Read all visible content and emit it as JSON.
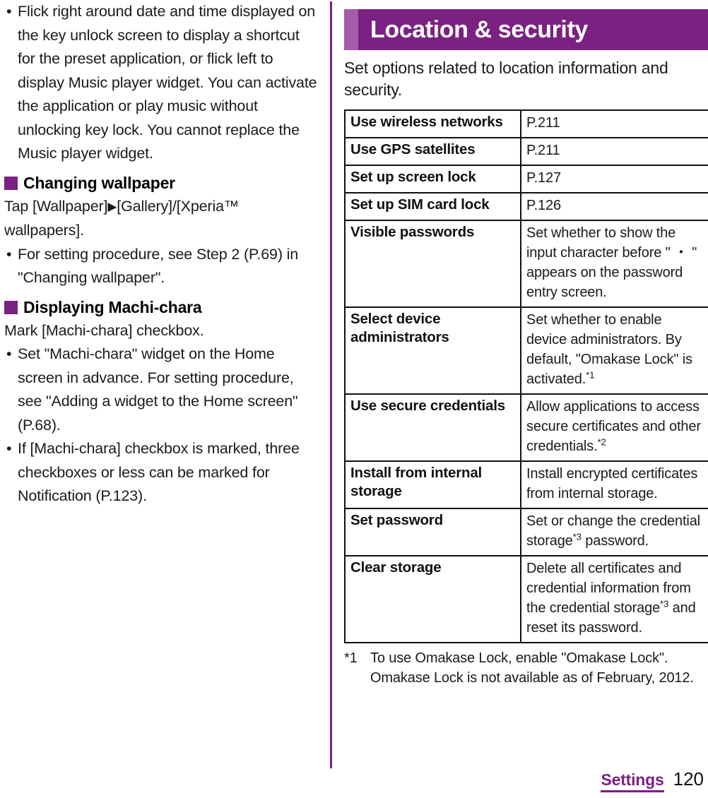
{
  "left_column": {
    "lead_bullet": {
      "marker": "•",
      "text": "Flick right around date and time displayed on the key unlock screen to display a shortcut for the preset application, or flick left to display Music player widget. You can activate the application or play music without unlocking key lock. You cannot replace the Music player widget."
    },
    "sections": [
      {
        "heading": "Changing wallpaper",
        "body_line": "Tap [Wallpaper]",
        "body_line_arrow": "▶",
        "body_line_rest": "[Gallery]/[Xperia™ wallpapers].",
        "bullets": [
          {
            "marker": "•",
            "text": "For setting procedure, see Step 2 (P.69) in \"Changing wallpaper\"."
          }
        ]
      },
      {
        "heading": "Displaying Machi-chara",
        "body_line": "Mark [Machi-chara] checkbox.",
        "bullets": [
          {
            "marker": "•",
            "text": "Set \"Machi-chara\" widget on the Home screen in advance. For setting procedure, see \"Adding a widget to the Home screen\" (P.68)."
          },
          {
            "marker": "•",
            "text": "If [Machi-chara] checkbox is marked, three checkboxes or less can be marked for Notification (P.123)."
          }
        ]
      }
    ]
  },
  "right_column": {
    "title": "Location & security",
    "intro": "Set options related to location information and security.",
    "table": {
      "rows": [
        {
          "name": "Use wireless networks",
          "desc": "P.211",
          "desc_sup": ""
        },
        {
          "name": "Use GPS satellites",
          "desc": "P.211",
          "desc_sup": ""
        },
        {
          "name": "Set up screen lock",
          "desc": "P.127",
          "desc_sup": ""
        },
        {
          "name": "Set up SIM card lock",
          "desc": "P.126",
          "desc_sup": ""
        },
        {
          "name": "Visible passwords",
          "desc": "Set whether to show the input character before \" ・ \" appears on the password entry screen.",
          "desc_sup": ""
        },
        {
          "name": "Select device administrators",
          "desc": "Set whether to enable device administrators. By default, \"Omakase Lock\" is activated.",
          "desc_sup": "*1"
        },
        {
          "name": "Use secure credentials",
          "desc": "Allow applications to access secure certificates and other credentials.",
          "desc_sup": "*2"
        },
        {
          "name": "Install from internal storage",
          "desc": "Install encrypted certificates from internal storage.",
          "desc_sup": ""
        },
        {
          "name": "Set password",
          "desc_pre": "Set or change the credential storage",
          "desc_sup": "*3",
          "desc_post": " password.",
          "desc": ""
        },
        {
          "name": "Clear storage",
          "desc_pre": "Delete all certificates and credential information from the credential storage",
          "desc_sup": "*3",
          "desc_post": " and reset its password.",
          "desc": ""
        }
      ]
    },
    "footnotes": [
      {
        "mark": "*1",
        "text": "To use Omakase Lock, enable \"Omakase Lock\". Omakase Lock is not available as of February, 2012."
      }
    ]
  },
  "footer": {
    "section": "Settings",
    "page": "120"
  },
  "colors": {
    "brand_purple": "#7a2182",
    "accent_purple": "#a65aa8",
    "text": "#1a1a1a",
    "table_border": "#111111"
  }
}
